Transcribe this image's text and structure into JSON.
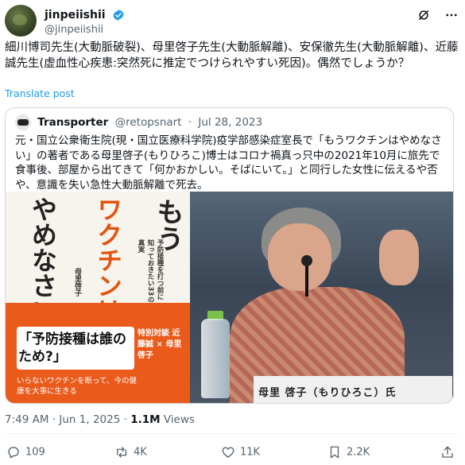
{
  "author": {
    "display_name": "jinpeiishii",
    "handle": "@jinpeiishii"
  },
  "post": {
    "text": "細川博司先生(大動脈破裂)、母里啓子先生(大動脈解離)、安保徹先生(大動脈解離)、近藤誠先生(虚血性心疾患:突然死に推定でつけられやすい死因)。偶然でしょうか？",
    "translate_label": "Translate post"
  },
  "quote": {
    "display_name": "Transporter",
    "handle": "@retopsnart",
    "separator": "·",
    "date": "Jul 28, 2023",
    "text": "元・国立公衆衛生院(現・国立医療科学院)疫学部感染症室長で「もうワクチンはやめなさい」の著者である母里啓子(もりひろこ)博士はコロナ禍真っ只中の2021年10月に旅先で食事後、部屋から出てきて「何かおかしい。そばにいて。」と同行した女性に伝えるや否や、意識を失い急性大動脈解離で死去。"
  },
  "book": {
    "title_col1": "もう",
    "title_col2": "ワクチンは",
    "title_col3": "やめなさい",
    "subtitle": "予防接種を打つ前に知っておきたい33の真実",
    "author": "母里啓子",
    "banner": "「予防接種は誰のため?」",
    "tagline": "いらないワクチンを断って、今の健康を大事に生きる",
    "dialogue": "特別対談 近藤誠 × 母里啓子"
  },
  "photo": {
    "nameplate": "母里 啓子（もりひろこ）氏"
  },
  "meta": {
    "time": "7:49 AM",
    "date": "Jun 1, 2025",
    "separator": "·",
    "views_count": "1.1M",
    "views_label": "Views"
  },
  "actions": {
    "replies": "109",
    "reposts": "4K",
    "likes": "11K",
    "bookmarks": "2.2K"
  },
  "colors": {
    "accent": "#1d9bf0",
    "book_orange": "#ea5a1a"
  }
}
